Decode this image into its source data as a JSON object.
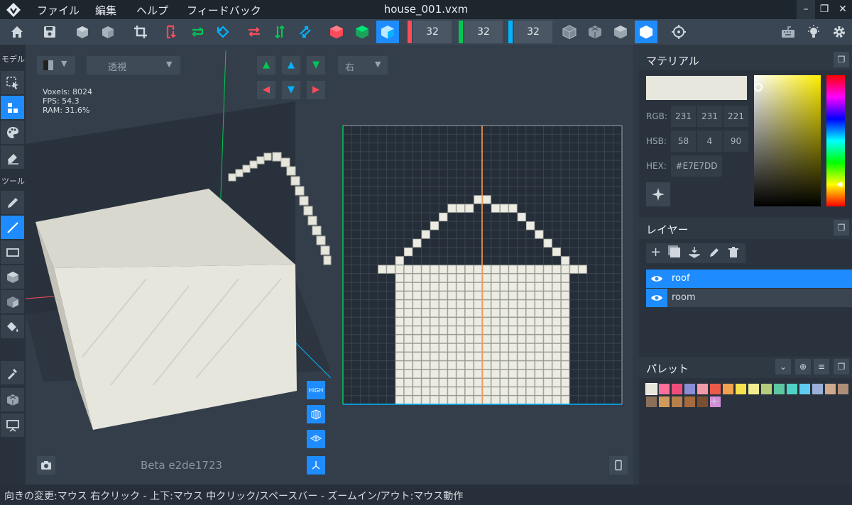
{
  "titlebar": {
    "app_icon": "diamond-logo-icon",
    "menu": [
      "ファイル",
      "編集",
      "ヘルプ",
      "フィードバック"
    ],
    "file_name": "house_001.vxm",
    "window_buttons": [
      "minimize-icon",
      "restore-icon",
      "close-icon"
    ]
  },
  "toolbar": {
    "dims": {
      "x": "32",
      "y": "32",
      "z": "32"
    },
    "colors": {
      "x": "#ff4a5a",
      "y": "#00c853",
      "z": "#00b4ff",
      "accent": "#1e8cff"
    },
    "icons": [
      "home-icon",
      "save-icon",
      "import-icon",
      "export-icon",
      "crop-icon",
      "flip-x-icon",
      "loop-y-icon",
      "rotate-z-icon",
      "swap-x-icon",
      "swap-y-icon",
      "swap-z-icon",
      "cube-red-icon",
      "cube-green-icon",
      "cube-blue-icon",
      "cube-wire-icon",
      "cube-grid-icon",
      "cube-solid-icon",
      "cube-white-icon",
      "target-icon",
      "keyboard-icon",
      "lightbulb-icon",
      "gear-icon"
    ]
  },
  "leftbar": {
    "model_label": "モデル",
    "tool_label": "ツール"
  },
  "viewport": {
    "view_mode": "透視",
    "direction": "右",
    "stats": {
      "voxels": "Voxels: 8024",
      "fps": "FPS: 54.3",
      "ram": "RAM: 31.6%"
    },
    "version": "Beta e2de1723",
    "view_buttons": [
      "HiGH",
      "wire-icon",
      "layers-icon",
      "axes-icon"
    ]
  },
  "material": {
    "title": "マテリアル",
    "current_color": "#E7E7DD",
    "rgb_label": "RGB:",
    "rgb": [
      "231",
      "231",
      "221"
    ],
    "hsb_label": "HSB:",
    "hsb": [
      "58",
      "4",
      "90"
    ],
    "hex_label": "HEX:",
    "hex": "#E7E7DD"
  },
  "layers": {
    "title": "レイヤー",
    "tools": [
      "add-icon",
      "duplicate-icon",
      "merge-icon",
      "edit-icon",
      "trash-icon"
    ],
    "items": [
      {
        "name": "roof",
        "selected": true
      },
      {
        "name": "room",
        "selected": false
      }
    ]
  },
  "palette": {
    "title": "パレット",
    "add_label": "+",
    "colors": [
      "#e7e7dd",
      "#ff6f9c",
      "#ee4d7a",
      "#8a8ed6",
      "#f29aa8",
      "#ee5a4a",
      "#f1a150",
      "#f6e14c",
      "#f3ed8f",
      "#b3cf7b",
      "#5dc7a1",
      "#4fd3c6",
      "#5fcdf3",
      "#9ab0d8",
      "#d0a88c",
      "#b08d77",
      "#8c6f5a",
      "#d29a5a",
      "#b77f4b",
      "#a66a3c",
      "#7a4e30",
      "#d48ed8"
    ]
  },
  "status": {
    "hint": "向きの変更:マウス 右クリック - 上下:マウス 中クリック/スペースバー - ズームイン/アウト:マウス動作"
  }
}
